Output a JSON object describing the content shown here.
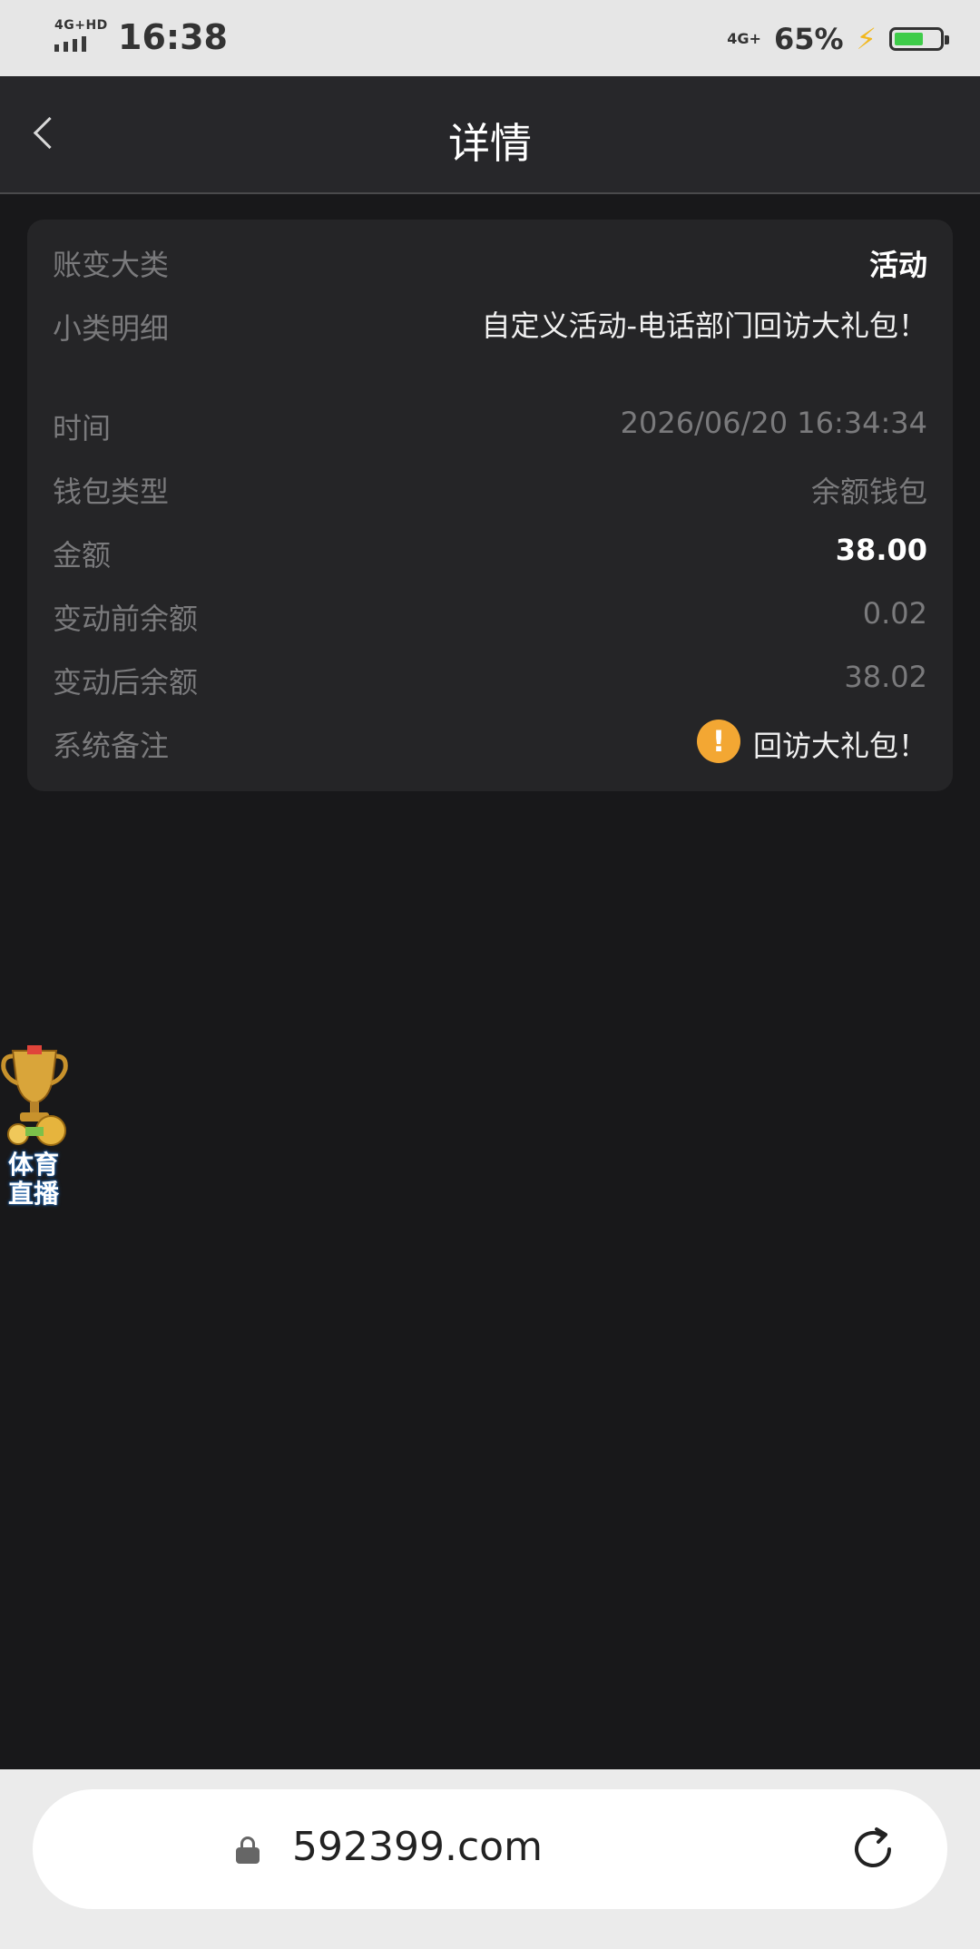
{
  "status_bar": {
    "network_left": "4G+HD",
    "time": "16:38",
    "network_right": "4G+",
    "battery_percent": "65%",
    "battery_level": 0.65,
    "charging": true
  },
  "header": {
    "title": "详情",
    "back_icon": "chevron-left-icon"
  },
  "details": {
    "category_label": "账变大类",
    "category_value": "活动",
    "subcategory_label": "小类明细",
    "subcategory_value": "自定义活动-电话部门回访大礼包！",
    "time_label": "时间",
    "time_value": "2026/06/20 16:34:34",
    "wallet_label": "钱包类型",
    "wallet_value": "余额钱包",
    "amount_label": "金额",
    "amount_value": "38.00",
    "before_label": "变动前余额",
    "before_value": "0.02",
    "after_label": "变动后余额",
    "after_value": "38.02",
    "remark_label": "系统备注",
    "remark_icon": "warning-icon",
    "remark_value": "回访大礼包！"
  },
  "floating_badge": {
    "icon": "trophy-icon",
    "text_line1": "体育",
    "text_line2": "直播"
  },
  "browser": {
    "url": "592399.com",
    "lock_icon": "lock-icon",
    "reload_icon": "reload-icon"
  },
  "colors": {
    "background": "#18181a",
    "header_bg": "#27272a",
    "card_bg": "#252527",
    "label": "#7a7a7c",
    "warning": "#f3a733",
    "battery_fill": "#3fcc4a"
  }
}
